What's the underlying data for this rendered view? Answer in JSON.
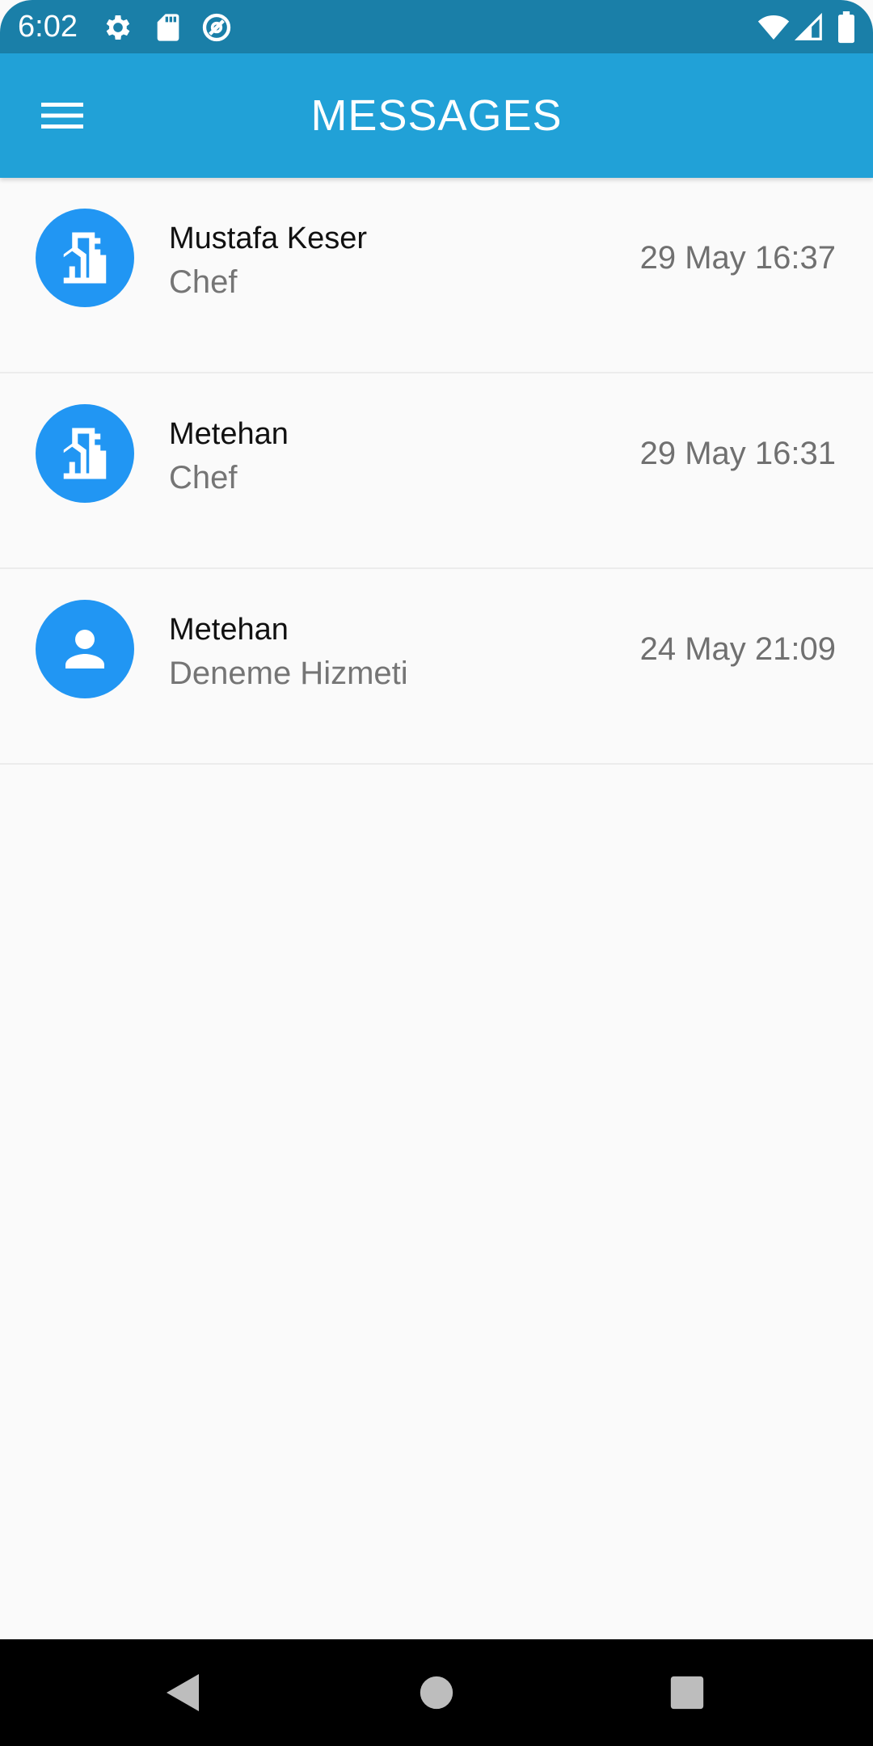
{
  "status_bar": {
    "time": "6:02",
    "left_icons": [
      "gear-icon",
      "sd-card-icon",
      "sync-icon"
    ],
    "right_icons": [
      "wifi-icon",
      "cellular-signal-icon",
      "battery-icon"
    ]
  },
  "app_bar": {
    "title": "MESSAGES",
    "menu_icon": "hamburger-menu-icon",
    "color": "#21a1d7"
  },
  "messages": [
    {
      "name": "Mustafa Keser",
      "subtitle": "Chef",
      "time": "29 May 16:37",
      "avatar_icon": "building-icon"
    },
    {
      "name": "Metehan",
      "subtitle": "Chef",
      "time": "29 May 16:31",
      "avatar_icon": "building-icon"
    },
    {
      "name": "Metehan",
      "subtitle": "Deneme Hizmeti",
      "time": "24 May 21:09",
      "avatar_icon": "person-icon"
    }
  ],
  "nav_bar": {
    "icons": [
      "back-icon",
      "home-icon",
      "recents-icon"
    ]
  },
  "colors": {
    "accent": "#2196f3",
    "status_bar": "#1a7fa8",
    "background": "#fafafa"
  }
}
